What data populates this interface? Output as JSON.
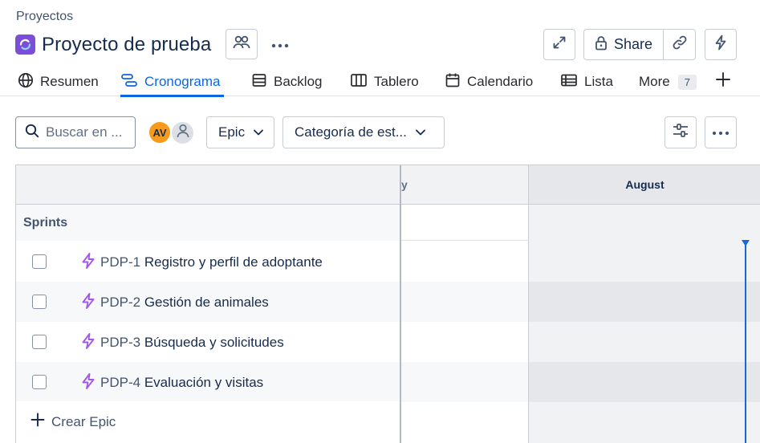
{
  "breadcrumb": "Proyectos",
  "project": {
    "title": "Proyecto de prueba"
  },
  "header_actions": {
    "share_label": "Share"
  },
  "tabs": [
    {
      "label": "Resumen",
      "icon": "globe-icon",
      "active": false
    },
    {
      "label": "Cronograma",
      "icon": "timeline-icon",
      "active": true
    },
    {
      "label": "Backlog",
      "icon": "backlog-icon",
      "active": false
    },
    {
      "label": "Tablero",
      "icon": "board-icon",
      "active": false
    },
    {
      "label": "Calendario",
      "icon": "calendar-icon",
      "active": false
    },
    {
      "label": "Lista",
      "icon": "list-icon",
      "active": false
    },
    {
      "label": "More",
      "icon": "",
      "active": false
    }
  ],
  "more_count": "7",
  "toolbar": {
    "search_placeholder": "Buscar en ...",
    "avatar_initials": "AV",
    "epic_filter": "Epic",
    "category_filter": "Categoría de est..."
  },
  "timeline": {
    "prev_month_partial": "y",
    "current_month": "August",
    "sprints_label": "Sprints",
    "create_epic_label": "Crear Epic"
  },
  "epics": [
    {
      "key": "PDP-1",
      "summary": "Registro y perfil de adoptante"
    },
    {
      "key": "PDP-2",
      "summary": "Gestión de animales"
    },
    {
      "key": "PDP-3",
      "summary": "Búsqueda y solicitudes"
    },
    {
      "key": "PDP-4",
      "summary": "Evaluación y visitas"
    }
  ],
  "colors": {
    "accent": "#0c66e4",
    "epic_purple": "#a557e8",
    "avatar_orange": "#f79b1d",
    "today_line": "#1868db"
  }
}
